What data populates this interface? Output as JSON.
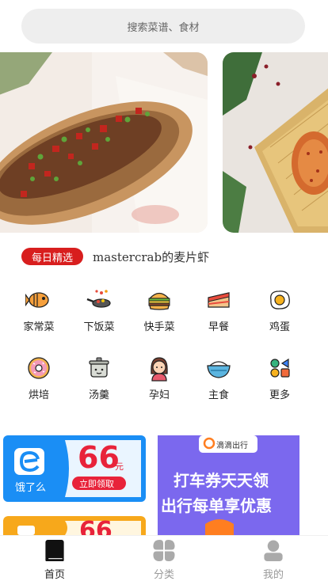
{
  "search": {
    "placeholder": "搜索菜谱、食材"
  },
  "banners": [
    {
      "name": "fish-dish-photo"
    },
    {
      "name": "fried-rice-basket-photo"
    }
  ],
  "daily": {
    "badge": "每日精选",
    "title": "mastercrab的麦片虾"
  },
  "categories": [
    {
      "label": "家常菜",
      "icon": "fish-icon"
    },
    {
      "label": "下饭菜",
      "icon": "frying-pan-icon"
    },
    {
      "label": "快手菜",
      "icon": "burger-icon"
    },
    {
      "label": "早餐",
      "icon": "cake-slice-icon"
    },
    {
      "label": "鸡蛋",
      "icon": "fried-egg-icon"
    },
    {
      "label": "烘培",
      "icon": "donut-icon"
    },
    {
      "label": "汤羹",
      "icon": "soup-pot-icon"
    },
    {
      "label": "孕妇",
      "icon": "woman-icon"
    },
    {
      "label": "主食",
      "icon": "rice-bowl-icon"
    },
    {
      "label": "更多",
      "icon": "shapes-icon"
    }
  ],
  "ads": {
    "eleme": {
      "brand": "饿了么",
      "amount": "66",
      "unit": "元",
      "button": "立即领取"
    },
    "didi": {
      "brand": "滴滴出行",
      "line1": "打车券天天领",
      "line2": "出行每单享优惠"
    },
    "third": {
      "amount": "66"
    }
  },
  "tabs": [
    {
      "label": "首页",
      "icon": "book-icon",
      "active": true
    },
    {
      "label": "分类",
      "icon": "grid-icon",
      "active": false
    },
    {
      "label": "我的",
      "icon": "user-icon",
      "active": false
    }
  ],
  "colors": {
    "accent": "#d81e1e",
    "eleme_blue": "#1a8ef5",
    "didi_purple": "#7b68ee",
    "didi_orange": "#ff7e20"
  }
}
